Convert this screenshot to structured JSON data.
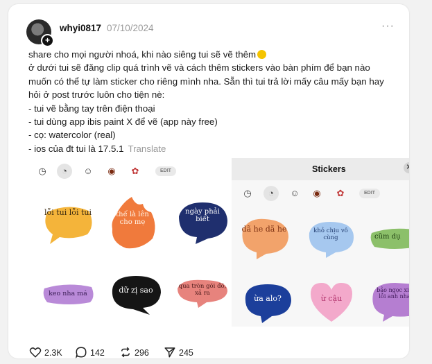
{
  "post": {
    "username": "whyi0817",
    "date": "07/10/2024",
    "lines": [
      "share cho mọi người nhoá, khi nào siêng tui sẽ vẽ thêm",
      "ở dưới tui sẽ đăng clip quá trình vẽ và cách thêm stickers vào bàn phím để bạn nào",
      "muốn có thể tự làm sticker cho riêng mình nha. Sẵn thì tui trả lời mấy câu mấy bạn hay",
      "hỏi ở post trước luôn cho tiện nè:",
      "- tui vẽ bằng tay trên điện thoại",
      "- tui dùng app ibis paint X để vẽ (app này free)",
      "- cọ: watercolor (real)",
      "- ios của đt tui là 17.5.1"
    ],
    "translate_label": "Translate",
    "emoji_icon": "grinning-sweat-emoji"
  },
  "media": {
    "panel_title": "Stickers",
    "edit_label": "EDIT",
    "stickers_left": [
      {
        "text": "lỗi tui lỗi tui",
        "color": "#f4b43a"
      },
      {
        "text": "thế là lên cho mẹ",
        "color": "#f07a3c"
      },
      {
        "text": "ngày phải biết",
        "color": "#1f2f6e"
      },
      {
        "text": "keo nha má",
        "color": "#b98ad8"
      },
      {
        "text": "dữ zị sao",
        "color": "#151515"
      },
      {
        "text": "qua tròn gói đó, xả ra",
        "color": "#e7837d"
      }
    ],
    "stickers_right": [
      {
        "text": "dã he dã he",
        "color": "#f2a36b"
      },
      {
        "text": "khỏ chịu vô cùng",
        "color": "#a6c8ef"
      },
      {
        "text": "cũm dụ",
        "color": "#8cc06a"
      },
      {
        "text": "ừa alo?",
        "color": "#1c3f9b"
      },
      {
        "text": "ừ cậu",
        "color": "#f3a9cb"
      },
      {
        "text": "bảo ngọc xin lỗi anh nha",
        "color": "#b57ed1"
      }
    ]
  },
  "actions": {
    "likes": "2.3K",
    "comments": "142",
    "reposts": "296",
    "shares": "245"
  }
}
